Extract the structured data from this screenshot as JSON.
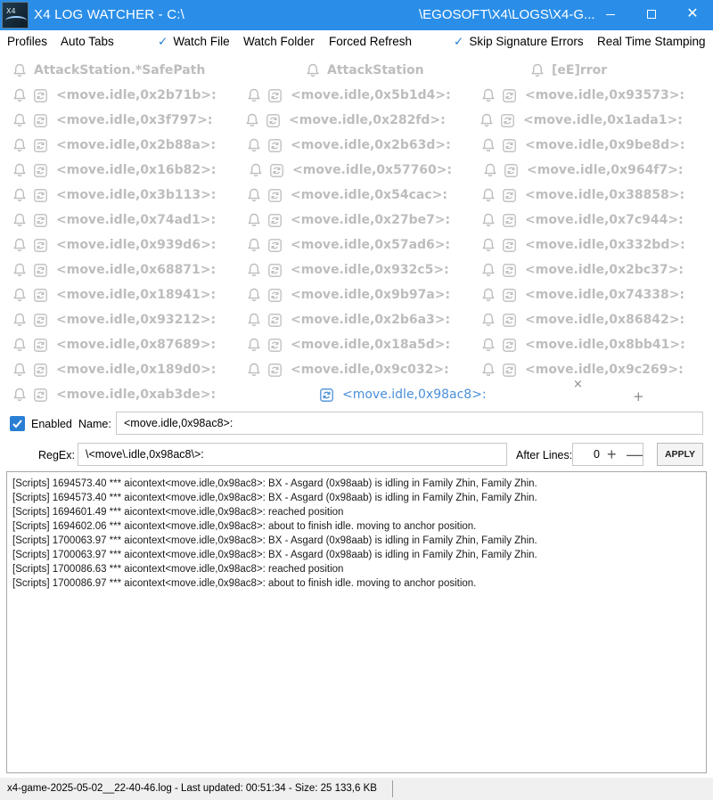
{
  "window": {
    "title_left": "X4 LOG WATCHER - C:\\",
    "title_right": "\\EGOSOFT\\X4\\LOGS\\X4-G...",
    "min_icon": "minimize-icon",
    "max_icon": "maximize-icon",
    "close_label": "✕"
  },
  "menu": {
    "profiles": "Profiles",
    "auto_tabs": "Auto Tabs",
    "watch_file": "Watch File",
    "watch_folder": "Watch Folder",
    "forced_refresh": "Forced Refresh",
    "skip_sig": "Skip Signature Errors",
    "real_time": "Real Time Stamping",
    "check": "✓"
  },
  "tabs": {
    "headers": [
      "AttackStation.*SafePath",
      "AttackStation",
      "[eE]rror"
    ],
    "col1": [
      "<move.idle,0x2b71b>:",
      "<move.idle,0x3f797>:",
      "<move.idle,0x2b88a>:",
      "<move.idle,0x16b82>:",
      "<move.idle,0x3b113>:",
      "<move.idle,0x74ad1>:",
      "<move.idle,0x939d6>:",
      "<move.idle,0x68871>:",
      "<move.idle,0x18941>:",
      "<move.idle,0x93212>:",
      "<move.idle,0x87689>:",
      "<move.idle,0x189d0>:",
      "<move.idle,0xab3de>:"
    ],
    "col2": [
      "<move.idle,0x5b1d4>:",
      "<move.idle,0x282fd>:",
      "<move.idle,0x2b63d>:",
      "<move.idle,0x57760>:",
      "<move.idle,0x54cac>:",
      "<move.idle,0x27be7>:",
      "<move.idle,0x57ad6>:",
      "<move.idle,0x932c5>:",
      "<move.idle,0x9b97a>:",
      "<move.idle,0x2b6a3>:",
      "<move.idle,0x18a5d>:",
      "<move.idle,0x9c032>:"
    ],
    "col3": [
      "<move.idle,0x93573>:",
      "<move.idle,0x1ada1>:",
      "<move.idle,0x9be8d>:",
      "<move.idle,0x964f7>:",
      "<move.idle,0x38858>:",
      "<move.idle,0x7c944>:",
      "<move.idle,0x332bd>:",
      "<move.idle,0x2bc37>:",
      "<move.idle,0x74338>:",
      "<move.idle,0x86842>:",
      "<move.idle,0x8bb41>:",
      "<move.idle,0x9c269>:"
    ],
    "active": "<move.idle,0x98ac8>:",
    "close_glyph": "×",
    "add_glyph": "+",
    "inactive_color": "#bdbdbd",
    "active_color": "#4a8fd8"
  },
  "filter": {
    "enabled_label": "Enabled",
    "name_label": "Name:",
    "name_value": "<move.idle,0x98ac8>:",
    "regex_label": "RegEx:",
    "regex_value": "\\<move\\.idle,0x98ac8\\>:",
    "after_lines_label": "After Lines:",
    "after_lines_value": "0",
    "plus": "+",
    "minus": "—",
    "apply_label": "APPLY"
  },
  "log_lines": [
    "[Scripts] 1694573.40 *** aicontext<move.idle,0x98ac8>: BX - Asgard (0x98aab) is idling in Family Zhin, Family Zhin.",
    "[Scripts] 1694573.40 *** aicontext<move.idle,0x98ac8>: BX - Asgard (0x98aab) is idling in Family Zhin, Family Zhin.",
    "[Scripts] 1694601.49 *** aicontext<move.idle,0x98ac8>: reached position",
    "[Scripts] 1694602.06 *** aicontext<move.idle,0x98ac8>: about to finish idle. moving to anchor position.",
    "[Scripts] 1700063.97 *** aicontext<move.idle,0x98ac8>: BX - Asgard (0x98aab) is idling in Family Zhin, Family Zhin.",
    "[Scripts] 1700063.97 *** aicontext<move.idle,0x98ac8>: BX - Asgard (0x98aab) is idling in Family Zhin, Family Zhin.",
    "[Scripts] 1700086.63 *** aicontext<move.idle,0x98ac8>: reached position",
    "[Scripts] 1700086.97 *** aicontext<move.idle,0x98ac8>: about to finish idle. moving to anchor position."
  ],
  "status": {
    "text": "x4-game-2025-05-02__22-40-46.log - Last updated: 00:51:34 - Size: 25 133,6 KB"
  }
}
